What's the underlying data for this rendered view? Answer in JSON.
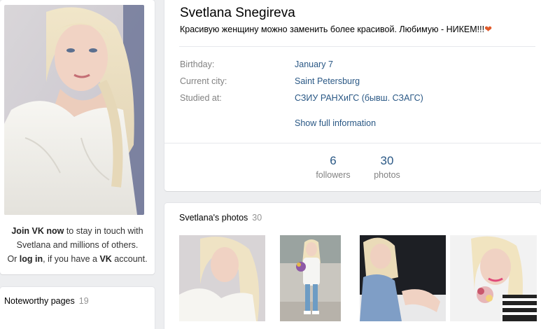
{
  "profile": {
    "name": "Svetlana Snegireva",
    "status": "Красивую женщину можно заменить более красивой. Любимую - НИКЕМ!!!",
    "status_emoji": "❤",
    "info": [
      {
        "label": "Birthday:",
        "value": "January 7"
      },
      {
        "label": "Current city:",
        "value": "Saint Petersburg"
      },
      {
        "label": "Studied at:",
        "value": "СЗИУ РАНХиГС (бывш. СЗАГС)"
      }
    ],
    "show_full_label": "Show full information",
    "counters": [
      {
        "num": "6",
        "label": "followers"
      },
      {
        "num": "30",
        "label": "photos"
      }
    ]
  },
  "join": {
    "bold1": "Join VK now",
    "text1": " to stay in touch with Svetlana and millions of others.",
    "text2": "Or ",
    "bold2": "log in",
    "text3": ", if you have a ",
    "bold3": "VK",
    "text4": " account."
  },
  "noteworthy": {
    "title": "Noteworthy pages",
    "count": "19"
  },
  "photos": {
    "title": "Svetlana's photos",
    "count": "30"
  },
  "colors": {
    "link": "#2a5885",
    "muted": "#828282",
    "page_bg": "#edeef0"
  }
}
